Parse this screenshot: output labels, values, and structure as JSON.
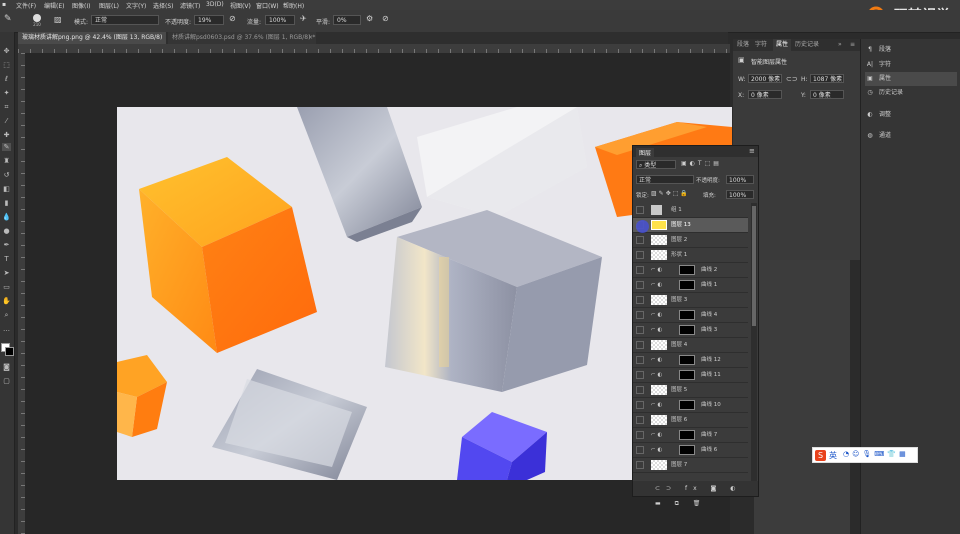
{
  "menu": [
    "文件(F)",
    "编辑(E)",
    "图像(I)",
    "图层(L)",
    "文字(Y)",
    "选择(S)",
    "滤镜(T)",
    "3D(D)",
    "视图(V)",
    "窗口(W)",
    "帮助(H)"
  ],
  "options": {
    "brush_size": "210",
    "mode_label": "模式:",
    "mode_value": "正常",
    "opacity_label": "不透明度:",
    "opacity_value": "19%",
    "flow_label": "流量:",
    "flow_value": "100%",
    "smooth_label": "平滑:",
    "smooth_value": "0%"
  },
  "tabs": [
    {
      "label": "玻璃材质讲解png.png @ 42.4% (图层 13, RGB/8) *",
      "close": "×"
    },
    {
      "label": "材质讲解psd0603.psd @ 37.6% (图层 1, RGB/8) *",
      "close": "×"
    }
  ],
  "dock_tabs": [
    "段落",
    "字符",
    "属性",
    "历史记录"
  ],
  "properties": {
    "title": "智能图层属性",
    "w_label": "W:",
    "w_value": "2000 像素",
    "h_label": "H:",
    "h_value": "1087 像素",
    "x_label": "X:",
    "x_value": "0 像素",
    "y_label": "Y:",
    "y_value": "0 像素"
  },
  "side_panel": [
    {
      "icon": "paragraph-icon",
      "glyph": "¶",
      "label": "段落"
    },
    {
      "icon": "character-icon",
      "glyph": "A|",
      "label": "字符"
    },
    {
      "icon": "properties-icon",
      "glyph": "▣",
      "label": "属性"
    },
    {
      "icon": "history-icon",
      "glyph": "◷",
      "label": "历史记录"
    },
    {
      "icon": "adjustments-icon",
      "glyph": "◐",
      "label": "调整"
    },
    {
      "icon": "channels-icon",
      "glyph": "◍",
      "label": "通道"
    }
  ],
  "layers_panel": {
    "title": "图层",
    "kind_label": "类型",
    "blend_mode": "正常",
    "opacity_label": "不透明度:",
    "opacity_value": "100%",
    "lock_label": "锁定:",
    "fill_label": "填充:",
    "fill_value": "100%",
    "layers": [
      {
        "name": "组 1",
        "type": "group"
      },
      {
        "name": "图层 13",
        "type": "selected"
      },
      {
        "name": "图层 2",
        "type": "normal"
      },
      {
        "name": "形状 1",
        "type": "normal"
      },
      {
        "name": "曲线 2",
        "type": "adjust"
      },
      {
        "name": "曲线 1",
        "type": "adjust"
      },
      {
        "name": "图层 3",
        "type": "normal"
      },
      {
        "name": "曲线 4",
        "type": "adjust"
      },
      {
        "name": "曲线 3",
        "type": "adjust"
      },
      {
        "name": "图层 4",
        "type": "normal"
      },
      {
        "name": "曲线 12",
        "type": "adjust"
      },
      {
        "name": "曲线 11",
        "type": "adjust"
      },
      {
        "name": "图层 5",
        "type": "normal"
      },
      {
        "name": "曲线 10",
        "type": "adjust"
      },
      {
        "name": "图层 6",
        "type": "normal"
      },
      {
        "name": "曲线 7",
        "type": "adjust"
      },
      {
        "name": "曲线 6",
        "type": "adjust"
      },
      {
        "name": "图层 7",
        "type": "normal"
      }
    ]
  },
  "ime": {
    "label": "英"
  },
  "logo": {
    "text": "玩转视觉"
  }
}
